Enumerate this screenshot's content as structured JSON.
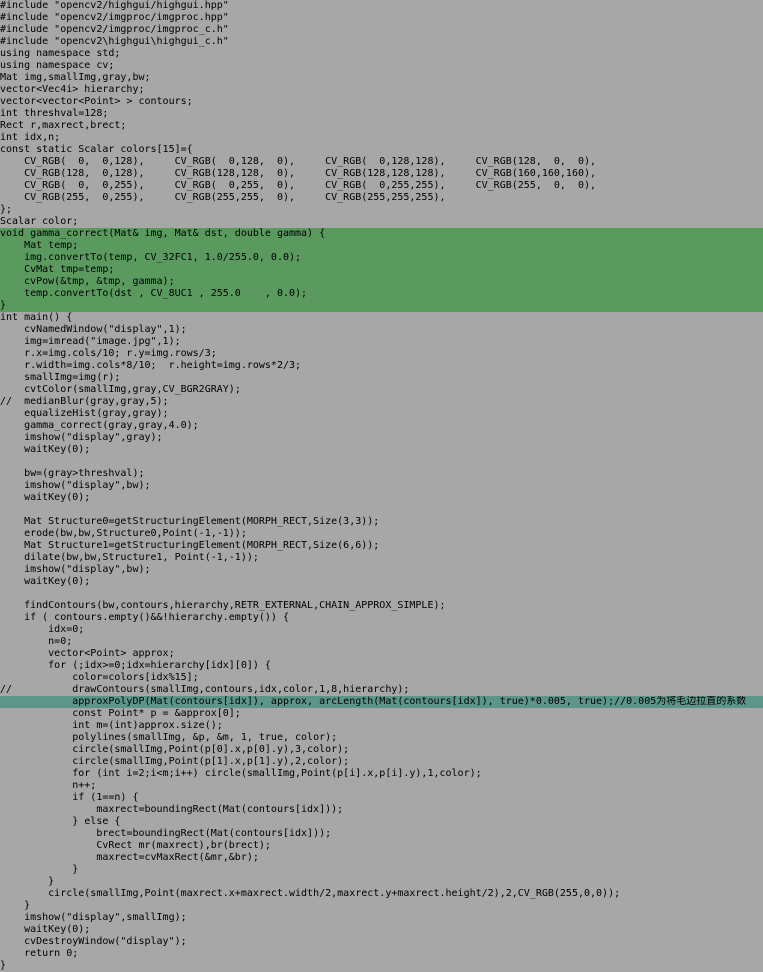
{
  "editor": {
    "colors": {
      "background": "#a7a7a7",
      "function_highlight": "#5a9a5f",
      "line_highlight": "#5c968b",
      "string": "#ffffff",
      "function_call": "#c04b7c"
    },
    "lines": [
      "#include \"opencv2/highgui/highgui.hpp\"",
      "#include \"opencv2/imgproc/imgproc.hpp\"",
      "#include \"opencv2/imgproc/imgproc_c.h\"",
      "#include \"opencv2\\highgui\\highgui_c.h\"",
      "using namespace std;",
      "using namespace cv;",
      "Mat img,smallImg,gray,bw;",
      "vector<Vec4i> hierarchy;",
      "vector<vector<Point> > contours;",
      "int threshval=128;",
      "Rect r,maxrect,brect;",
      "int idx,n;",
      "const static Scalar colors[15]={",
      "    CV_RGB(  0,  0,128),     CV_RGB(  0,128,  0),     CV_RGB(  0,128,128),     CV_RGB(128,  0,  0),",
      "    CV_RGB(128,  0,128),     CV_RGB(128,128,  0),     CV_RGB(128,128,128),     CV_RGB(160,160,160),",
      "    CV_RGB(  0,  0,255),     CV_RGB(  0,255,  0),     CV_RGB(  0,255,255),     CV_RGB(255,  0,  0),",
      "    CV_RGB(255,  0,255),     CV_RGB(255,255,  0),     CV_RGB(255,255,255),",
      "};",
      "Scalar color;",
      "void gamma_correct(Mat& img, Mat& dst, double gamma) {",
      "    Mat temp;",
      "    img.convertTo(temp, CV_32FC1, 1.0/255.0, 0.0);",
      "    CvMat tmp=temp;",
      "    cvPow(&tmp, &tmp, gamma);",
      "    temp.convertTo(dst , CV_8UC1 , 255.0    , 0.0);",
      "}",
      "int main() {",
      "    cvNamedWindow(\"display\",1);",
      "    img=imread(\"image.jpg\",1);",
      "    r.x=img.cols/10; r.y=img.rows/3;",
      "    r.width=img.cols*8/10;  r.height=img.rows*2/3;",
      "    smallImg=img(r);",
      "    cvtColor(smallImg,gray,CV_BGR2GRAY);",
      "//  medianBlur(gray,gray,5);",
      "    equalizeHist(gray,gray);",
      "    gamma_correct(gray,gray,4.0);",
      "    imshow(\"display\",gray);",
      "    waitKey(0);",
      "",
      "    bw=(gray>threshval);",
      "    imshow(\"display\",bw);",
      "    waitKey(0);",
      "",
      "    Mat Structure0=getStructuringElement(MORPH_RECT,Size(3,3));",
      "    erode(bw,bw,Structure0,Point(-1,-1));",
      "    Mat Structure1=getStructuringElement(MORPH_RECT,Size(6,6));",
      "    dilate(bw,bw,Structure1, Point(-1,-1));",
      "    imshow(\"display\",bw);",
      "    waitKey(0);",
      "",
      "    findContours(bw,contours,hierarchy,RETR_EXTERNAL,CHAIN_APPROX_SIMPLE);",
      "    if ( contours.empty()&&!hierarchy.empty()) {",
      "        idx=0;",
      "        n=0;",
      "        vector<Point> approx;",
      "        for (;idx>=0;idx=hierarchy[idx][0]) {",
      "            color=colors[idx%15];",
      "//          drawContours(smallImg,contours,idx,color,1,8,hierarchy);",
      "            approxPolyDP(Mat(contours[idx]), approx, arcLength(Mat(contours[idx]), true)*0.005, true);//0.005为将毛边拉直的系数",
      "            const Point* p = &approx[0];",
      "            int m=(int)approx.size();",
      "            polylines(smallImg, &p, &m, 1, true, color);",
      "            circle(smallImg,Point(p[0].x,p[0].y),3,color);",
      "            circle(smallImg,Point(p[1].x,p[1].y),2,color);",
      "            for (int i=2;i<m;i++) circle(smallImg,Point(p[i].x,p[i].y),1,color);",
      "            n++;",
      "            if (1==n) {",
      "                maxrect=boundingRect(Mat(contours[idx]));",
      "            } else {",
      "                brect=boundingRect(Mat(contours[idx]));",
      "                CvRect mr(maxrect),br(brect);",
      "                maxrect=cvMaxRect(&mr,&br);",
      "            }",
      "        }",
      "        circle(smallImg,Point(maxrect.x+maxrect.width/2,maxrect.y+maxrect.height/2),2,CV_RGB(255,0,0));",
      "    }",
      "    imshow(\"display\",smallImg);",
      "    waitKey(0);",
      "    cvDestroyWindow(\"display\");",
      "    return 0;",
      "}"
    ]
  }
}
